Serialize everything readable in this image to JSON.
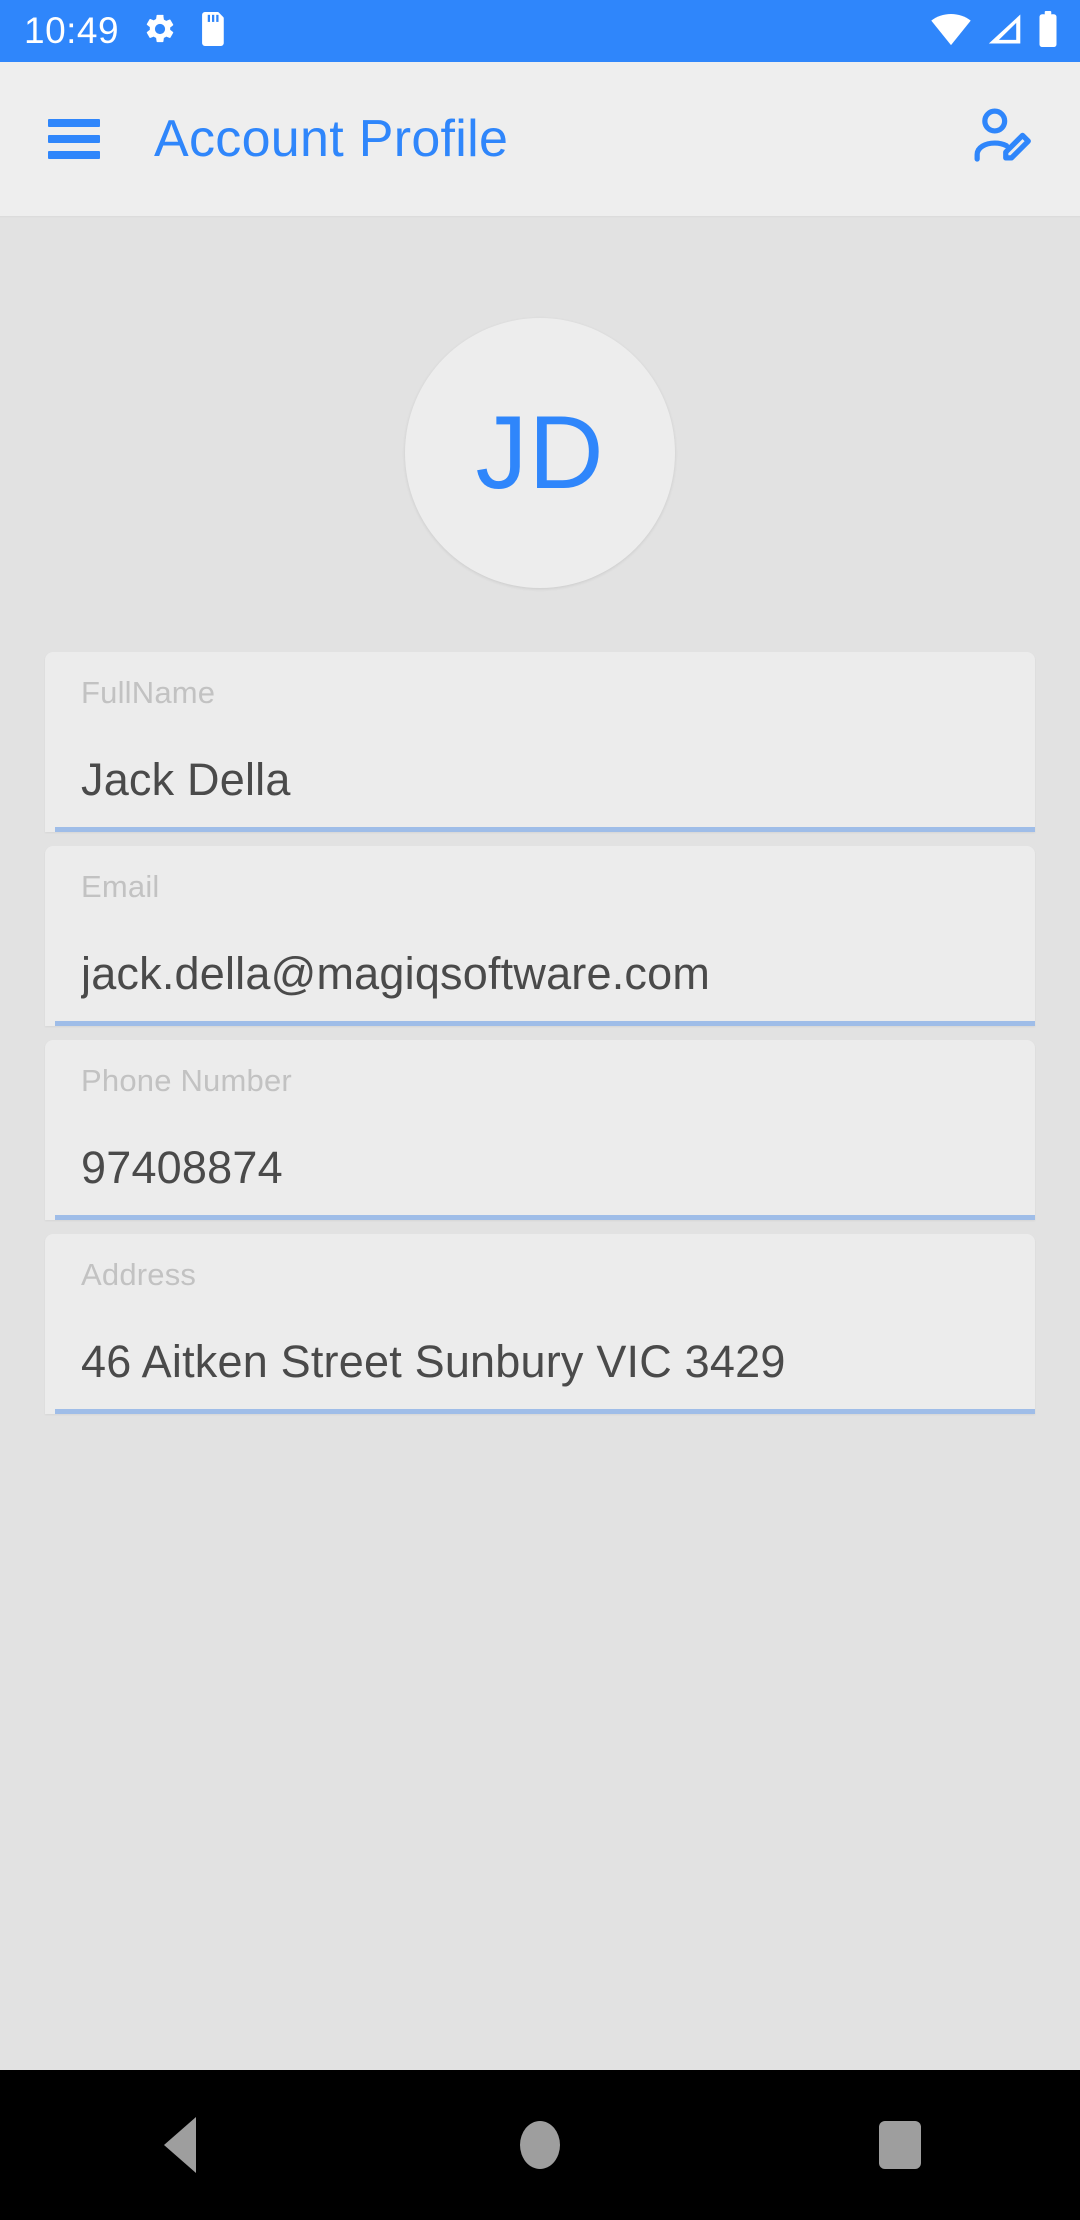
{
  "status_bar": {
    "time": "10:49",
    "icons": [
      "settings-gear-icon",
      "sd-card-icon"
    ],
    "right_icons": [
      "wifi-icon",
      "cellular-signal-icon",
      "battery-icon"
    ],
    "background_color": "#2f86fb"
  },
  "app_bar": {
    "menu_icon": "hamburger-menu-icon",
    "title": "Account Profile",
    "action_icon": "edit-profile-icon",
    "title_color": "#2f86fb",
    "background_color": "#eeeeee"
  },
  "profile": {
    "avatar_initials": "JD",
    "avatar_text_color": "#2f86fb",
    "avatar_background": "#ededed"
  },
  "fields": [
    {
      "label": "FullName",
      "value": "Jack Della"
    },
    {
      "label": "Email",
      "value": "jack.della@magiqsoftware.com"
    },
    {
      "label": "Phone Number",
      "value": "97408874"
    },
    {
      "label": "Address",
      "value": "46 Aitken Street Sunbury VIC 3429"
    }
  ],
  "theme": {
    "accent": "#2f86fb",
    "underline": "#9fbde8",
    "page_background": "#e2e2e2",
    "card_background": "#ececec",
    "label_color": "#c2c2c2",
    "value_color": "#4a4a4a"
  },
  "nav_bar": {
    "back_icon": "back-triangle-icon",
    "home_icon": "home-circle-icon",
    "recents_icon": "recents-square-icon",
    "background_color": "#000000"
  }
}
